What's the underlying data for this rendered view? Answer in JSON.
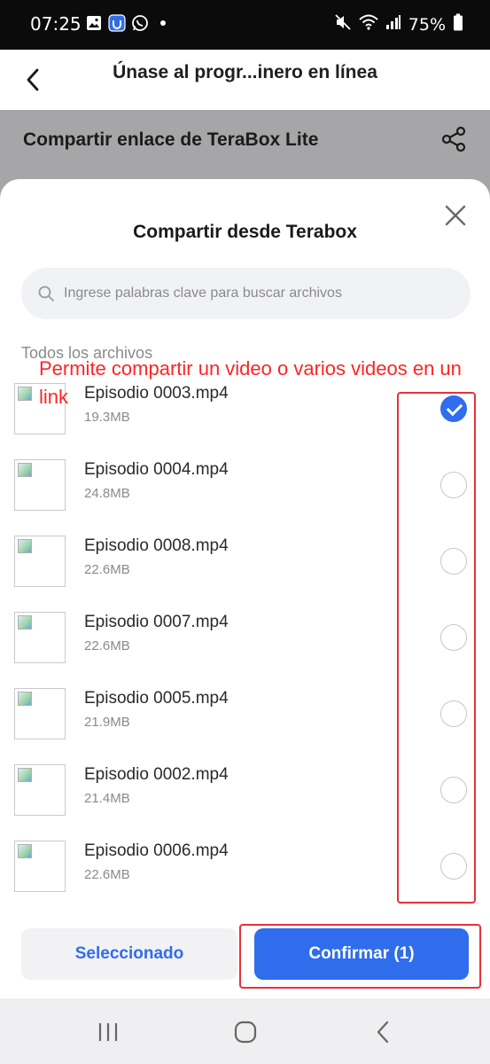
{
  "status_bar": {
    "time": "07:25",
    "battery": "75%"
  },
  "header": {
    "title": "Únase al progr...inero en línea"
  },
  "page": {
    "share_section_label": "Compartir enlace de TeraBox Lite"
  },
  "sheet": {
    "title": "Compartir desde Terabox",
    "search_placeholder": "Ingrese palabras clave para buscar archivos",
    "breadcrumb": "Todos los archivos",
    "annotation": "Permite compartir un video o varios videos en un link",
    "files": [
      {
        "name": "Episodio 0003.mp4",
        "size": "19.3MB",
        "selected": true
      },
      {
        "name": "Episodio 0004.mp4",
        "size": "24.8MB",
        "selected": false
      },
      {
        "name": "Episodio 0008.mp4",
        "size": "22.6MB",
        "selected": false
      },
      {
        "name": "Episodio 0007.mp4",
        "size": "22.6MB",
        "selected": false
      },
      {
        "name": "Episodio 0005.mp4",
        "size": "21.9MB",
        "selected": false
      },
      {
        "name": "Episodio 0002.mp4",
        "size": "21.4MB",
        "selected": false
      },
      {
        "name": "Episodio 0006.mp4",
        "size": "22.6MB",
        "selected": false
      }
    ],
    "selected_button": "Seleccionado",
    "confirm_button": "Confirmar (1)"
  },
  "colors": {
    "accent": "#2f6ded",
    "annotation": "#ff2424",
    "dim": "#a6a6a8"
  },
  "icons": [
    "image-icon",
    "app-icon",
    "whatsapp-icon",
    "mute-icon",
    "wifi-icon",
    "signal-icon",
    "battery-icon",
    "back-arrow-icon",
    "share-icon",
    "close-icon",
    "search-icon",
    "recents-icon",
    "home-icon",
    "nav-back-icon"
  ]
}
